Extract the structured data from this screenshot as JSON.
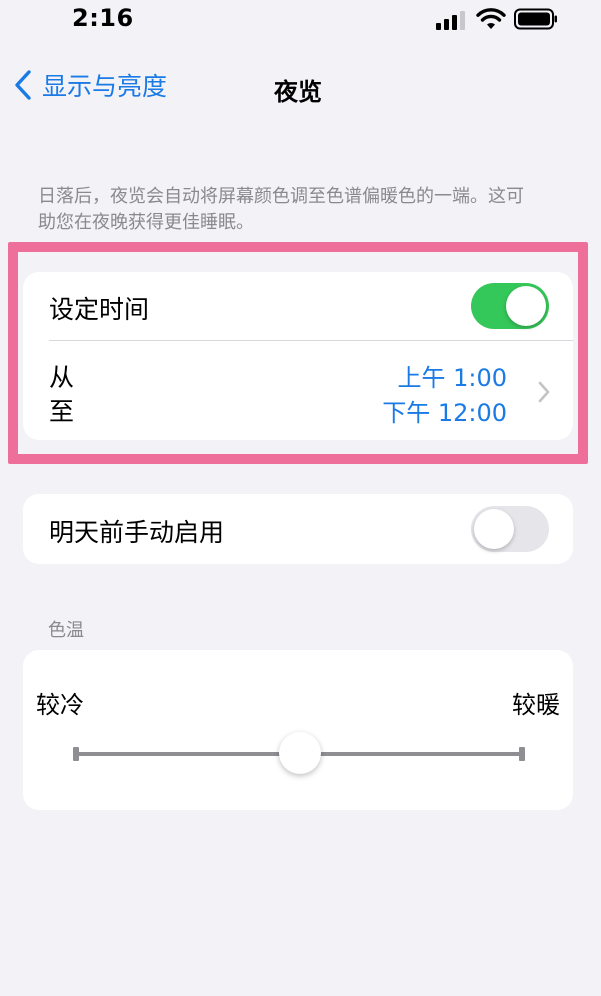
{
  "status_bar": {
    "time": "2:16",
    "signal_icon": "cellular-signal-icon",
    "wifi_icon": "wifi-icon",
    "battery_icon": "battery-icon"
  },
  "nav": {
    "back_label": "显示与亮度",
    "title": "夜览"
  },
  "description": "日落后，夜览会自动将屏幕颜色调至色谱偏暖色的一端。这可助您在夜晚获得更佳睡眠。",
  "schedule": {
    "label": "设定时间",
    "toggle_on": true,
    "from_label": "从",
    "to_label": "至",
    "from_value": "上午 1:00",
    "to_value": "下午 12:00"
  },
  "manual": {
    "label": "明天前手动启用",
    "toggle_on": false
  },
  "color_temp": {
    "header": "色温",
    "cooler_label": "较冷",
    "warmer_label": "较暖",
    "level": 0.5
  },
  "colors": {
    "accent": "#1a7ae6",
    "toggle_on": "#34c759",
    "highlight": "#ee6f99"
  }
}
